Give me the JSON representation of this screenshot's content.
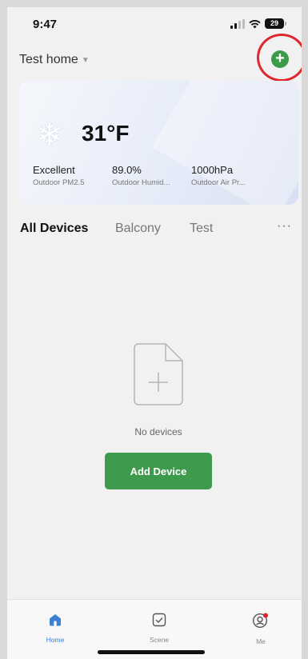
{
  "status_bar": {
    "time": "9:47",
    "battery": "29"
  },
  "header": {
    "home_name": "Test home",
    "add_label": "+"
  },
  "weather": {
    "temperature": "31°F",
    "stats": [
      {
        "value": "Excellent",
        "label": "Outdoor PM2.5"
      },
      {
        "value": "89.0%",
        "label": "Outdoor Humid..."
      },
      {
        "value": "1000hPa",
        "label": "Outdoor Air Pr..."
      }
    ]
  },
  "tabs": {
    "items": [
      {
        "label": "All Devices",
        "active": true
      },
      {
        "label": "Balcony",
        "active": false
      },
      {
        "label": "Test",
        "active": false
      }
    ],
    "more": "···"
  },
  "empty_state": {
    "text": "No devices",
    "button": "Add Device"
  },
  "tabbar": {
    "items": [
      {
        "label": "Home",
        "icon": "home-icon"
      },
      {
        "label": "Scene",
        "icon": "scene-check-icon"
      },
      {
        "label": "Me",
        "icon": "profile-icon"
      }
    ]
  },
  "colors": {
    "accent_green": "#3e9a4c",
    "active_blue": "#3d7fd4",
    "highlight_red": "#e0262a"
  }
}
